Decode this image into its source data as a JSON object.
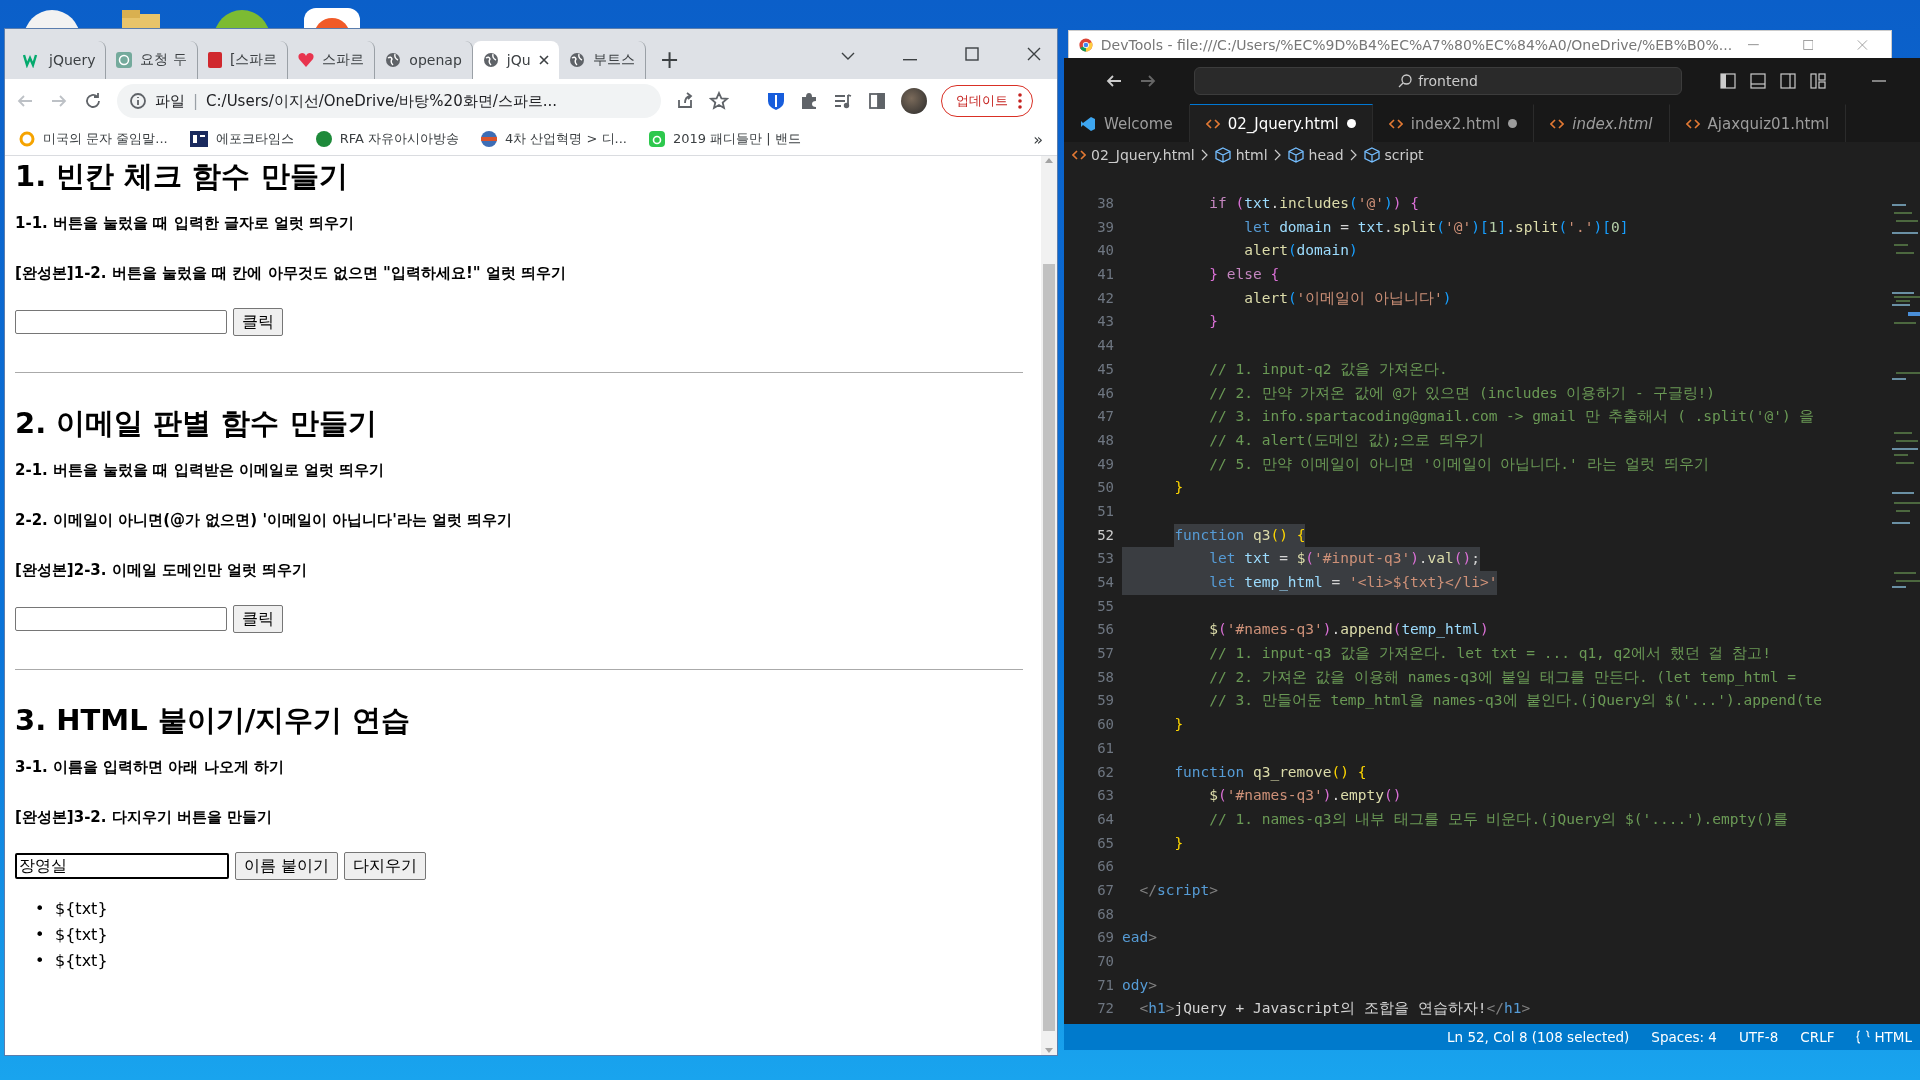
{
  "browser": {
    "tabs": [
      {
        "label": "jQuery",
        "selected": false
      },
      {
        "label": "요청 두",
        "selected": false
      },
      {
        "label": "[스파르",
        "selected": false
      },
      {
        "label": "스파르",
        "selected": false
      },
      {
        "label": "openap",
        "selected": false
      },
      {
        "label": "jQu",
        "selected": true
      },
      {
        "label": "부트스",
        "selected": false
      }
    ],
    "new_tab": "+",
    "address": {
      "scheme": "파일",
      "separator": "|",
      "url": "C:/Users/이지선/OneDrive/바탕%20화면/스파르..."
    },
    "update_button": "업데이트",
    "bookmarks": [
      "미국의 문자 줄임말...",
      "에포크타임스",
      "RFA 자유아시아방송",
      "4차 산업혁명 > 디...",
      "2019 패디들만 | 밴드"
    ],
    "bookmarks_more": "»",
    "page": {
      "sections": [
        {
          "title": "1. 빈칸 체크 함수 만들기",
          "notes": [
            "1-1. 버튼을 눌렀을 때 입력한 글자로 얼럿 띄우기",
            "[완성본]1-2. 버튼을 눌렀을 때 칸에 아무것도 없으면 \"입력하세요!\" 얼럿 띄우기"
          ],
          "input": {
            "focused": false
          },
          "buttons": [
            "클릭"
          ]
        },
        {
          "title": "2. 이메일 판별 함수 만들기",
          "notes": [
            "2-1. 버튼을 눌렀을 때 입력받은 이메일로 얼럿 띄우기",
            "2-2. 이메일이 아니면(@가 없으면) '이메일이 아닙니다'라는 얼럿 띄우기",
            "[완성본]2-3. 이메일 도메인만 얼럿 띄우기"
          ],
          "input": {
            "focused": false
          },
          "buttons": [
            "클릭"
          ]
        },
        {
          "title": "3. HTML 붙이기/지우기 연습",
          "notes": [
            "3-1. 이름을 입력하면 아래 나오게 하기",
            "[완성본]3-2. 다지우기 버튼을 만들기"
          ],
          "input": {
            "value": "장영실",
            "focused": true
          },
          "buttons": [
            "이름 붙이기",
            "다지우기"
          ],
          "list": [
            {
              "bullet": "•",
              "text": "${txt}"
            },
            {
              "bullet": "•",
              "text": "${txt}"
            },
            {
              "bullet": "•",
              "text": "${txt}"
            }
          ]
        }
      ]
    }
  },
  "devtools_title": "DevTools - file:///C:/Users/%EC%9D%B4%EC%A7%80%EC%84%A0/OneDrive/%EB%B0%...",
  "editor": {
    "search": "frontend",
    "tabs": [
      {
        "label": "Welcome",
        "kind": "welcome",
        "selected": false,
        "dirty": false,
        "preview": false
      },
      {
        "label": "02_Jquery.html",
        "kind": "html",
        "selected": true,
        "dirty": true,
        "preview": false
      },
      {
        "label": "index2.html",
        "kind": "html",
        "selected": false,
        "dirty": true,
        "preview": false
      },
      {
        "label": "index.html",
        "kind": "html",
        "selected": false,
        "dirty": false,
        "preview": true
      },
      {
        "label": "Ajaxquiz01.html",
        "kind": "html",
        "selected": false,
        "dirty": false,
        "preview": false
      }
    ],
    "breadcrumbs": [
      {
        "label": "02_Jquery.html",
        "kind": "html"
      },
      {
        "label": "html",
        "kind": "element"
      },
      {
        "label": "head",
        "kind": "element"
      },
      {
        "label": "script",
        "kind": "element"
      }
    ],
    "lines": [
      {
        "n": "38",
        "sel": false,
        "active": false,
        "t": [
          {
            "ctl": "          if "
          },
          {
            "b2": "("
          },
          {
            "v": "txt"
          },
          {
            "p": "."
          },
          {
            "f": "includes"
          },
          {
            "b3": "("
          },
          {
            "s": "'@'"
          },
          {
            "b3": ")"
          },
          {
            "b2": ") {"
          }
        ]
      },
      {
        "n": "39",
        "sel": false,
        "active": false,
        "t": [
          {
            "k": "              let "
          },
          {
            "v": "domain"
          },
          {
            "p": " = "
          },
          {
            "v": "txt"
          },
          {
            "p": "."
          },
          {
            "f": "split"
          },
          {
            "b3": "("
          },
          {
            "s": "'@'"
          },
          {
            "b3": ")["
          },
          {
            "num": "1"
          },
          {
            "b3": "]"
          },
          {
            "p": "."
          },
          {
            "f": "split"
          },
          {
            "b3": "("
          },
          {
            "s": "'.'"
          },
          {
            "b3": ")["
          },
          {
            "num": "0"
          },
          {
            "b3": "]"
          }
        ]
      },
      {
        "n": "40",
        "sel": false,
        "active": false,
        "t": [
          {
            "f": "              alert"
          },
          {
            "b3": "("
          },
          {
            "v": "domain"
          },
          {
            "b3": ")"
          }
        ]
      },
      {
        "n": "41",
        "sel": false,
        "active": false,
        "t": [
          {
            "b2": "          } "
          },
          {
            "ctl": "else "
          },
          {
            "b2": "{"
          }
        ]
      },
      {
        "n": "42",
        "sel": false,
        "active": false,
        "t": [
          {
            "f": "              alert"
          },
          {
            "b3": "("
          },
          {
            "s": "'이메일이 아닙니다'"
          },
          {
            "b3": ")"
          }
        ]
      },
      {
        "n": "43",
        "sel": false,
        "active": false,
        "t": [
          {
            "b2": "          }"
          }
        ]
      },
      {
        "n": "44",
        "active": false
      },
      {
        "n": "45",
        "sel": false,
        "active": false,
        "t": [
          {
            "c": "          // 1. input-q2 값을 가져온다."
          }
        ]
      },
      {
        "n": "46",
        "sel": false,
        "active": false,
        "t": [
          {
            "c": "          // 2. 만약 가져온 값에 @가 있으면 (includes 이용하기 - 구글링!)"
          }
        ]
      },
      {
        "n": "47",
        "sel": false,
        "active": false,
        "t": [
          {
            "c": "          // 3. info.spartacoding@gmail.com -> gmail 만 추출해서 ( .split('@') 을"
          }
        ]
      },
      {
        "n": "48",
        "sel": false,
        "active": false,
        "t": [
          {
            "c": "          // 4. alert(도메인 값);으로 띄우기"
          }
        ]
      },
      {
        "n": "49",
        "sel": false,
        "active": false,
        "t": [
          {
            "c": "          // 5. 만약 이메일이 아니면 '이메일이 아닙니다.' 라는 얼럿 띄우기"
          }
        ]
      },
      {
        "n": "50",
        "sel": false,
        "active": false,
        "t": [
          {
            "b1": "      }"
          }
        ]
      },
      {
        "n": "51",
        "active": false
      },
      {
        "n": "52",
        "sel": true,
        "active": true,
        "t": [
          {
            "k": "      function "
          },
          {
            "f": "q3"
          },
          {
            "b1": "() {"
          }
        ]
      },
      {
        "n": "53",
        "sel": true,
        "active": false,
        "t": [
          {
            "k": "          let "
          },
          {
            "v": "txt"
          },
          {
            "p": " = "
          },
          {
            "f": "$"
          },
          {
            "b2": "("
          },
          {
            "s": "'#input-q3'"
          },
          {
            "b2": ")"
          },
          {
            "p": "."
          },
          {
            "f": "val"
          },
          {
            "b2": "()"
          },
          {
            "p": ";"
          }
        ]
      },
      {
        "n": "54",
        "sel": true,
        "active": false,
        "t": [
          {
            "k": "          let "
          },
          {
            "v": "temp_html"
          },
          {
            "p": " = "
          },
          {
            "s": "'<li>${txt}</li>'"
          }
        ]
      },
      {
        "n": "55",
        "active": false
      },
      {
        "n": "56",
        "sel": false,
        "active": false,
        "t": [
          {
            "f": "          $"
          },
          {
            "b2": "("
          },
          {
            "s": "'#names-q3'"
          },
          {
            "b2": ")"
          },
          {
            "p": "."
          },
          {
            "f": "append"
          },
          {
            "b2": "("
          },
          {
            "v": "temp_html"
          },
          {
            "b2": ")"
          }
        ]
      },
      {
        "n": "57",
        "sel": false,
        "active": false,
        "t": [
          {
            "c": "          // 1. input-q3 값을 가져온다. let txt = ... q1, q2에서 했던 걸 참고!"
          }
        ]
      },
      {
        "n": "58",
        "sel": false,
        "active": false,
        "t": [
          {
            "c": "          // 2. 가져온 값을 이용해 names-q3에 붙일 태그를 만든다. (let temp_html ="
          }
        ]
      },
      {
        "n": "59",
        "sel": false,
        "active": false,
        "t": [
          {
            "c": "          // 3. 만들어둔 temp_html을 names-q3에 붙인다.(jQuery의 $('...').append(te"
          }
        ]
      },
      {
        "n": "60",
        "sel": false,
        "active": false,
        "t": [
          {
            "b1": "      }"
          }
        ]
      },
      {
        "n": "61",
        "active": false
      },
      {
        "n": "62",
        "sel": false,
        "active": false,
        "t": [
          {
            "k": "      function "
          },
          {
            "f": "q3_remove"
          },
          {
            "b1": "() {"
          }
        ]
      },
      {
        "n": "63",
        "sel": false,
        "active": false,
        "t": [
          {
            "f": "          $"
          },
          {
            "b2": "("
          },
          {
            "s": "'#names-q3'"
          },
          {
            "b2": ")"
          },
          {
            "p": "."
          },
          {
            "f": "empty"
          },
          {
            "b2": "()"
          }
        ]
      },
      {
        "n": "64",
        "sel": false,
        "active": false,
        "t": [
          {
            "c": "          // 1. names-q3의 내부 태그를 모두 비운다.(jQuery의 $('....').empty()를"
          }
        ]
      },
      {
        "n": "65",
        "sel": false,
        "active": false,
        "t": [
          {
            "b1": "      }"
          }
        ]
      },
      {
        "n": "66",
        "active": false
      },
      {
        "n": "67",
        "sel": false,
        "active": false,
        "t": [
          {
            "tag": "  </"
          },
          {
            "tn": "script"
          },
          {
            "tag": ">"
          }
        ]
      },
      {
        "n": "68",
        "active": false
      },
      {
        "n": "69",
        "sel": false,
        "active": false,
        "t": [
          {
            "tn": "ead"
          },
          {
            "tag": ">"
          }
        ]
      },
      {
        "n": "70",
        "active": false
      },
      {
        "n": "71",
        "sel": false,
        "active": false,
        "t": [
          {
            "tn": "ody"
          },
          {
            "tag": ">"
          }
        ]
      },
      {
        "n": "72",
        "sel": false,
        "active": false,
        "t": [
          {
            "tag": "  <"
          },
          {
            "tn": "h1"
          },
          {
            "tag": ">"
          },
          {
            "p": "jQuery + Javascript의 조합을 연습하자!"
          },
          {
            "tag": "</"
          },
          {
            "tn": "h1"
          },
          {
            "tag": ">"
          }
        ]
      }
    ],
    "status": [
      "Ln 52, Col 8 (108 selected)",
      "Spaces: 4",
      "UTF-8",
      "CRLF"
    ],
    "language": "HTML"
  }
}
